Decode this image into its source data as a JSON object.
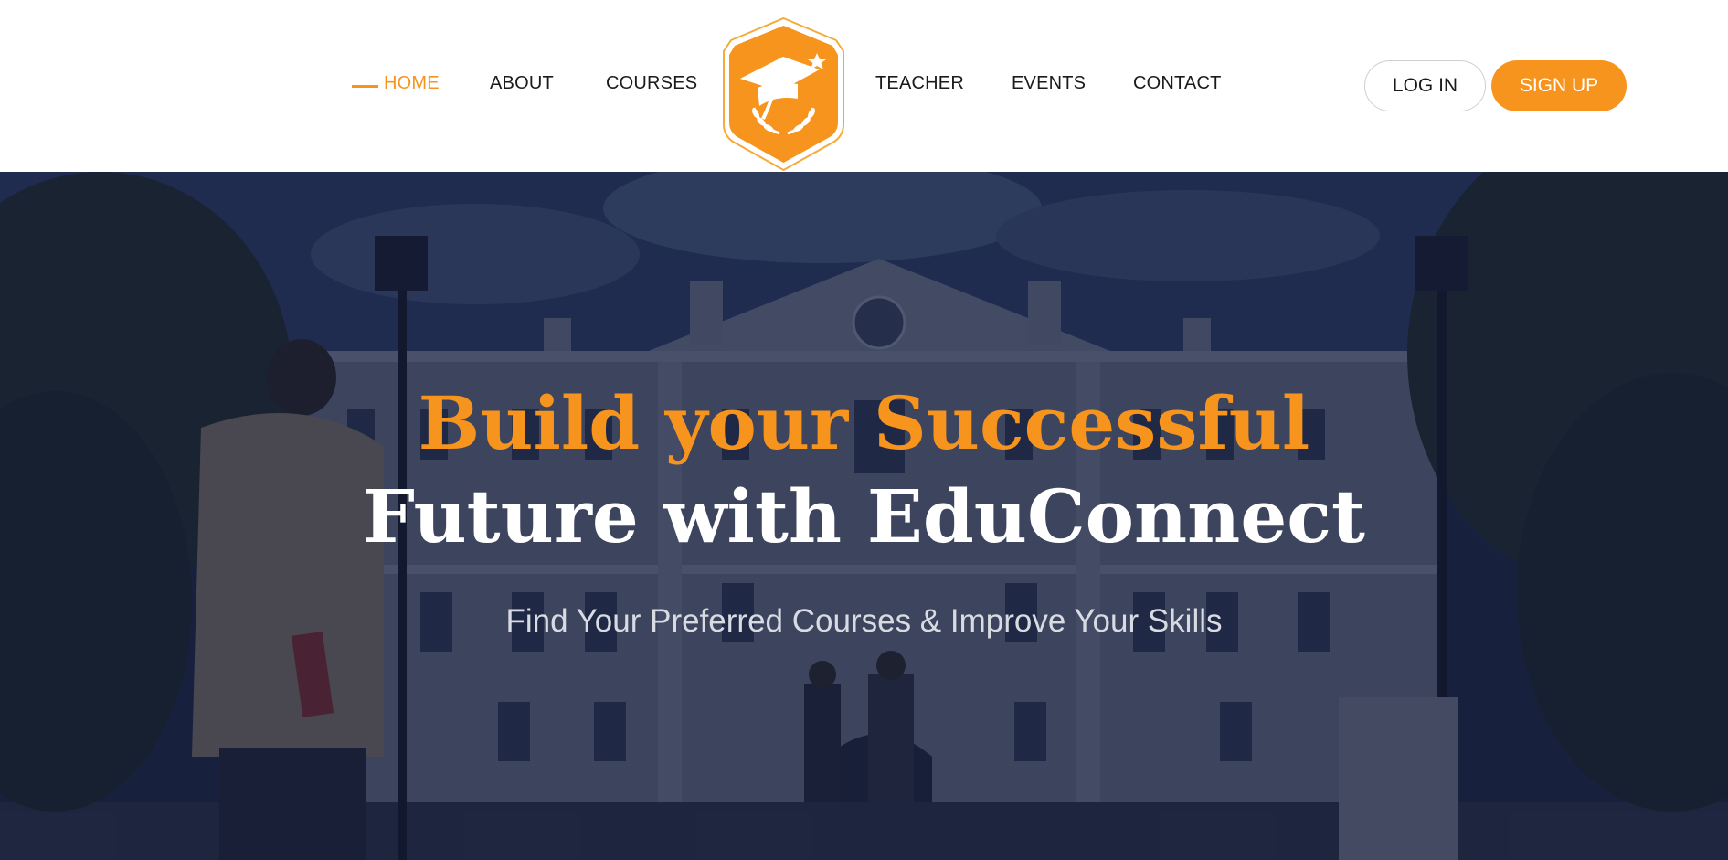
{
  "nav": {
    "left_items": [
      {
        "label": "HOME",
        "active": true
      },
      {
        "label": "ABOUT",
        "active": false
      },
      {
        "label": "COURSES",
        "active": false
      }
    ],
    "right_items": [
      {
        "label": "TEACHER",
        "active": false
      },
      {
        "label": "EVENTS",
        "active": false
      },
      {
        "label": "CONTACT",
        "active": false
      }
    ],
    "logo_icon": "graduation-cap-shield-logo"
  },
  "auth": {
    "login_label": "LOG IN",
    "signup_label": "SIGN UP"
  },
  "hero": {
    "headline_line1": "Build your Successful",
    "headline_line2": "Future with EduConnect",
    "subtitle": "Find Your Preferred Courses & Improve Your Skills",
    "background": "campus-building-photo"
  },
  "colors": {
    "accent": "#f7941d",
    "text_dark": "#1b1b1b",
    "hero_overlay": "#141e3a"
  }
}
